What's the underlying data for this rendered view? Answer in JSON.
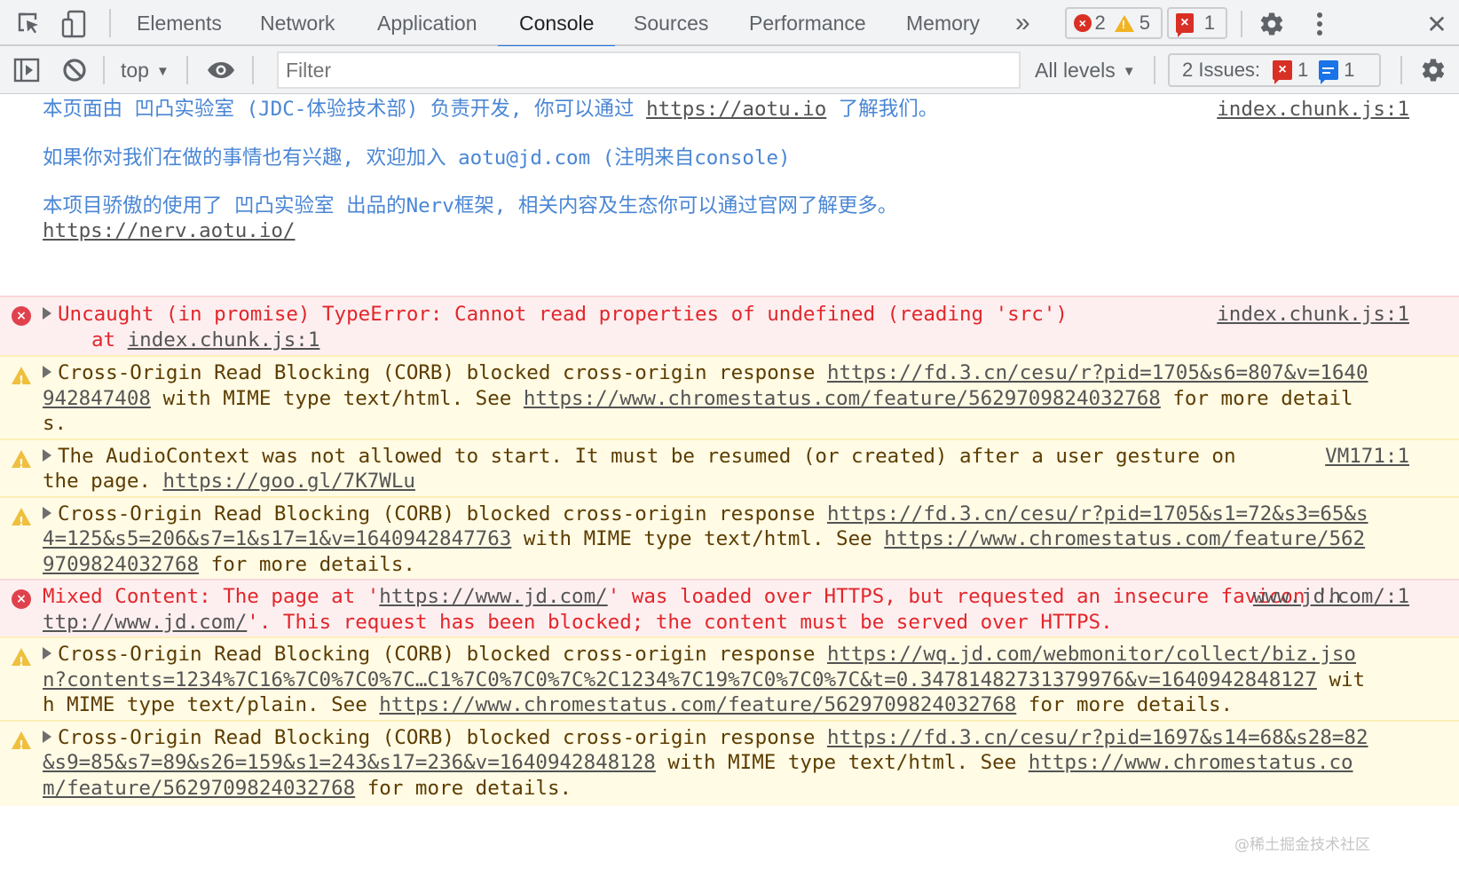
{
  "tabbar": {
    "tabs": [
      {
        "label": "Elements",
        "active": false
      },
      {
        "label": "Network",
        "active": false
      },
      {
        "label": "Application",
        "active": false
      },
      {
        "label": "Console",
        "active": true
      },
      {
        "label": "Sources",
        "active": false
      },
      {
        "label": "Performance",
        "active": false
      },
      {
        "label": "Memory",
        "active": false
      }
    ],
    "more_tabs_glyph": "»",
    "error_count": "2",
    "warning_count": "5",
    "issue_error_count": "1",
    "close_glyph": "✕"
  },
  "toolbar": {
    "context": "top",
    "filter_placeholder": "Filter",
    "filter_value": "",
    "levels": "All levels",
    "issues_label": "2 Issues:",
    "issues_error_count": "1",
    "issues_info_count": "1"
  },
  "messages": [
    {
      "level": "info",
      "lines": [
        {
          "text": "本页面由 凹凸实验室 (JDC-体验技术部) 负责开发, 你可以通过 ",
          "link": "https://aotu.io",
          "after": " 了解我们。"
        },
        {
          "text": ""
        },
        {
          "text": "如果你对我们在做的事情也有兴趣, 欢迎加入 aotu@jd.com (注明来自console)"
        },
        {
          "text": ""
        },
        {
          "text": "本项目骄傲的使用了 凹凸实验室 出品的Nerv框架, 相关内容及生态你可以通过官网了解更多。"
        },
        {
          "link": "https://nerv.aotu.io/"
        }
      ],
      "source": "index.chunk.js:1"
    },
    {
      "level": "error",
      "text": "Uncaught (in promise) TypeError: Cannot read properties of undefined (reading 'src')",
      "stack_prefix": "at ",
      "stack_link": "index.chunk.js:1",
      "source": "index.chunk.js:1"
    },
    {
      "level": "warning",
      "text": "Cross-Origin Read Blocking (CORB) blocked cross-origin response ",
      "link1": "https://fd.3.cn/cesu/r?pid=1705&s6=807&v=1640942847408",
      "mid": " with MIME type text/html. See ",
      "link2": "https://www.chromestatus.com/feature/5629709824032768",
      "tail": " for more details."
    },
    {
      "level": "warning",
      "text": "The AudioContext was not allowed to start. It must be resumed (or created) after a user gesture on the page. ",
      "link1": "https://goo.gl/7K7WLu",
      "source": "VM171:1"
    },
    {
      "level": "warning",
      "text": "Cross-Origin Read Blocking (CORB) blocked cross-origin response ",
      "link1": "https://fd.3.cn/cesu/r?pid=1705&s1=72&s3=65&s4=125&s5=206&s7=1&s17=1&v=1640942847763",
      "mid": " with MIME type text/html. See ",
      "link2": "https://www.chromestatus.com/feature/5629709824032768",
      "tail": " for more details."
    },
    {
      "level": "error",
      "text": "Mixed Content: The page at '",
      "link1": "https://www.jd.com/",
      "mid": "' was loaded over HTTPS, but requested an insecure favicon '",
      "link2": "http://www.jd.com/",
      "tail": "'. This request has been blocked; the content must be served over HTTPS.",
      "source": "www.jd.com/:1"
    },
    {
      "level": "warning",
      "text": "Cross-Origin Read Blocking (CORB) blocked cross-origin response ",
      "link1": "https://wq.jd.com/webmonitor/collect/biz.json?contents=1234%7C16%7C0%7C0%7C…C1%7C0%7C0%7C%2C1234%7C19%7C0%7C0%7C&t=0.34781482731379976&v=1640942848127",
      "mid": " with MIME type text/plain. See ",
      "link2": "https://www.chromestatus.com/feature/5629709824032768",
      "tail": " for more details."
    },
    {
      "level": "warning",
      "text": "Cross-Origin Read Blocking (CORB) blocked cross-origin response ",
      "link1": "https://fd.3.cn/cesu/r?pid=1697&s14=68&s28=82&s9=85&s7=89&s26=159&s1=243&s17=236&v=1640942848128",
      "mid": " with MIME type text/html. See ",
      "link2": "https://www.chromestatus.com/feature/5629709824032768",
      "tail": " for more details."
    }
  ],
  "watermark": "@稀土掘金技术社区",
  "colors": {
    "accent": "#1a73e8",
    "error_text": "#e2262b",
    "error_bg": "#fdeff0",
    "warning_text": "#5c3c00",
    "warning_bg": "#fffbe5",
    "info_text": "#4a86d4"
  }
}
